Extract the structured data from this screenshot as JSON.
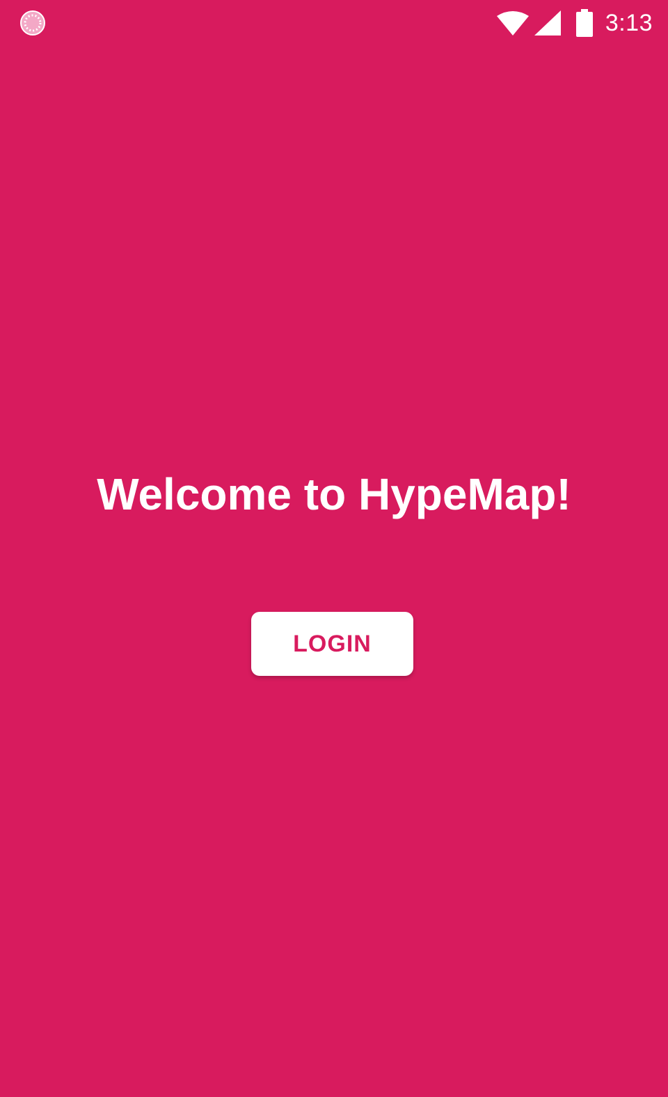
{
  "status_bar": {
    "time": "3:13",
    "notification_icon": "spinner-notification-icon",
    "wifi_icon": "wifi-icon",
    "signal_icon": "cell-signal-icon",
    "battery_icon": "battery-icon"
  },
  "main": {
    "title": "Welcome to HypeMap!",
    "login_label": "LOGIN"
  },
  "colors": {
    "background": "#d81b5e",
    "button_background": "#ffffff",
    "button_text": "#d81b5e",
    "text": "#ffffff"
  }
}
